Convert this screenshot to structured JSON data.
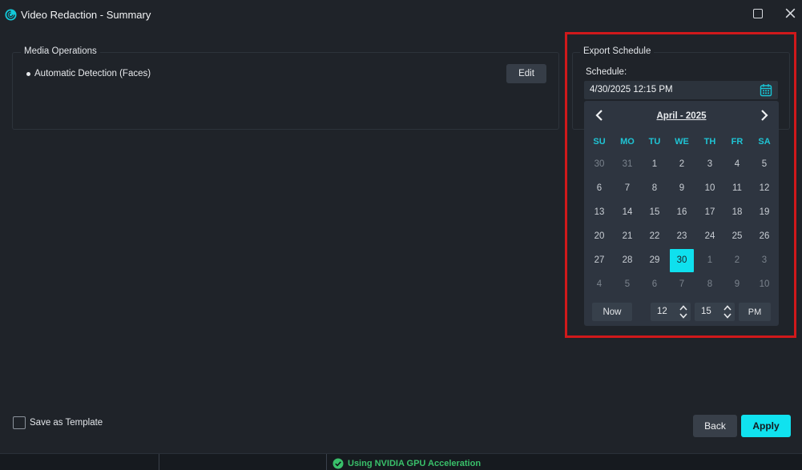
{
  "window": {
    "title": "Video Redaction - Summary",
    "icon": "app-logo-icon",
    "controls": [
      "maximize-icon",
      "close-icon"
    ]
  },
  "media_operations": {
    "heading": "Media Operations",
    "items": [
      "Automatic Detection (Faces)"
    ],
    "edit_label": "Edit"
  },
  "export_schedule": {
    "heading": "Export Schedule",
    "schedule_label": "Schedule:",
    "schedule_value": "4/30/2025 12:15 PM",
    "calendar_icon": "calendar-icon"
  },
  "calendar": {
    "month_label": "April - 2025",
    "weekdays": [
      "SU",
      "MO",
      "TU",
      "WE",
      "TH",
      "FR",
      "SA"
    ],
    "weeks": [
      [
        {
          "d": "30",
          "o": true
        },
        {
          "d": "31",
          "o": true
        },
        {
          "d": "1"
        },
        {
          "d": "2"
        },
        {
          "d": "3"
        },
        {
          "d": "4"
        },
        {
          "d": "5"
        }
      ],
      [
        {
          "d": "6"
        },
        {
          "d": "7"
        },
        {
          "d": "8"
        },
        {
          "d": "9"
        },
        {
          "d": "10"
        },
        {
          "d": "11"
        },
        {
          "d": "12"
        }
      ],
      [
        {
          "d": "13"
        },
        {
          "d": "14"
        },
        {
          "d": "15"
        },
        {
          "d": "16"
        },
        {
          "d": "17"
        },
        {
          "d": "18"
        },
        {
          "d": "19"
        }
      ],
      [
        {
          "d": "20"
        },
        {
          "d": "21"
        },
        {
          "d": "22"
        },
        {
          "d": "23"
        },
        {
          "d": "24"
        },
        {
          "d": "25"
        },
        {
          "d": "26"
        }
      ],
      [
        {
          "d": "27"
        },
        {
          "d": "28"
        },
        {
          "d": "29"
        },
        {
          "d": "30",
          "s": true
        },
        {
          "d": "1",
          "o": true
        },
        {
          "d": "2",
          "o": true
        },
        {
          "d": "3",
          "o": true
        }
      ],
      [
        {
          "d": "4",
          "o": true
        },
        {
          "d": "5",
          "o": true
        },
        {
          "d": "6",
          "o": true
        },
        {
          "d": "7",
          "o": true
        },
        {
          "d": "8",
          "o": true
        },
        {
          "d": "9",
          "o": true
        },
        {
          "d": "10",
          "o": true
        }
      ]
    ],
    "now_label": "Now",
    "hour": "12",
    "minute": "15",
    "ampm": "PM"
  },
  "footer": {
    "template_label": "Save as Template",
    "template_checked": false,
    "back_label": "Back",
    "apply_label": "Apply"
  },
  "status": {
    "text": "Using NVIDIA GPU Acceleration",
    "icon": "check-circle-icon"
  },
  "colors": {
    "background": "#1f2329",
    "accent": "#10e2ef",
    "highlight_border": "#d0191b",
    "status_ok": "#39c06a"
  }
}
